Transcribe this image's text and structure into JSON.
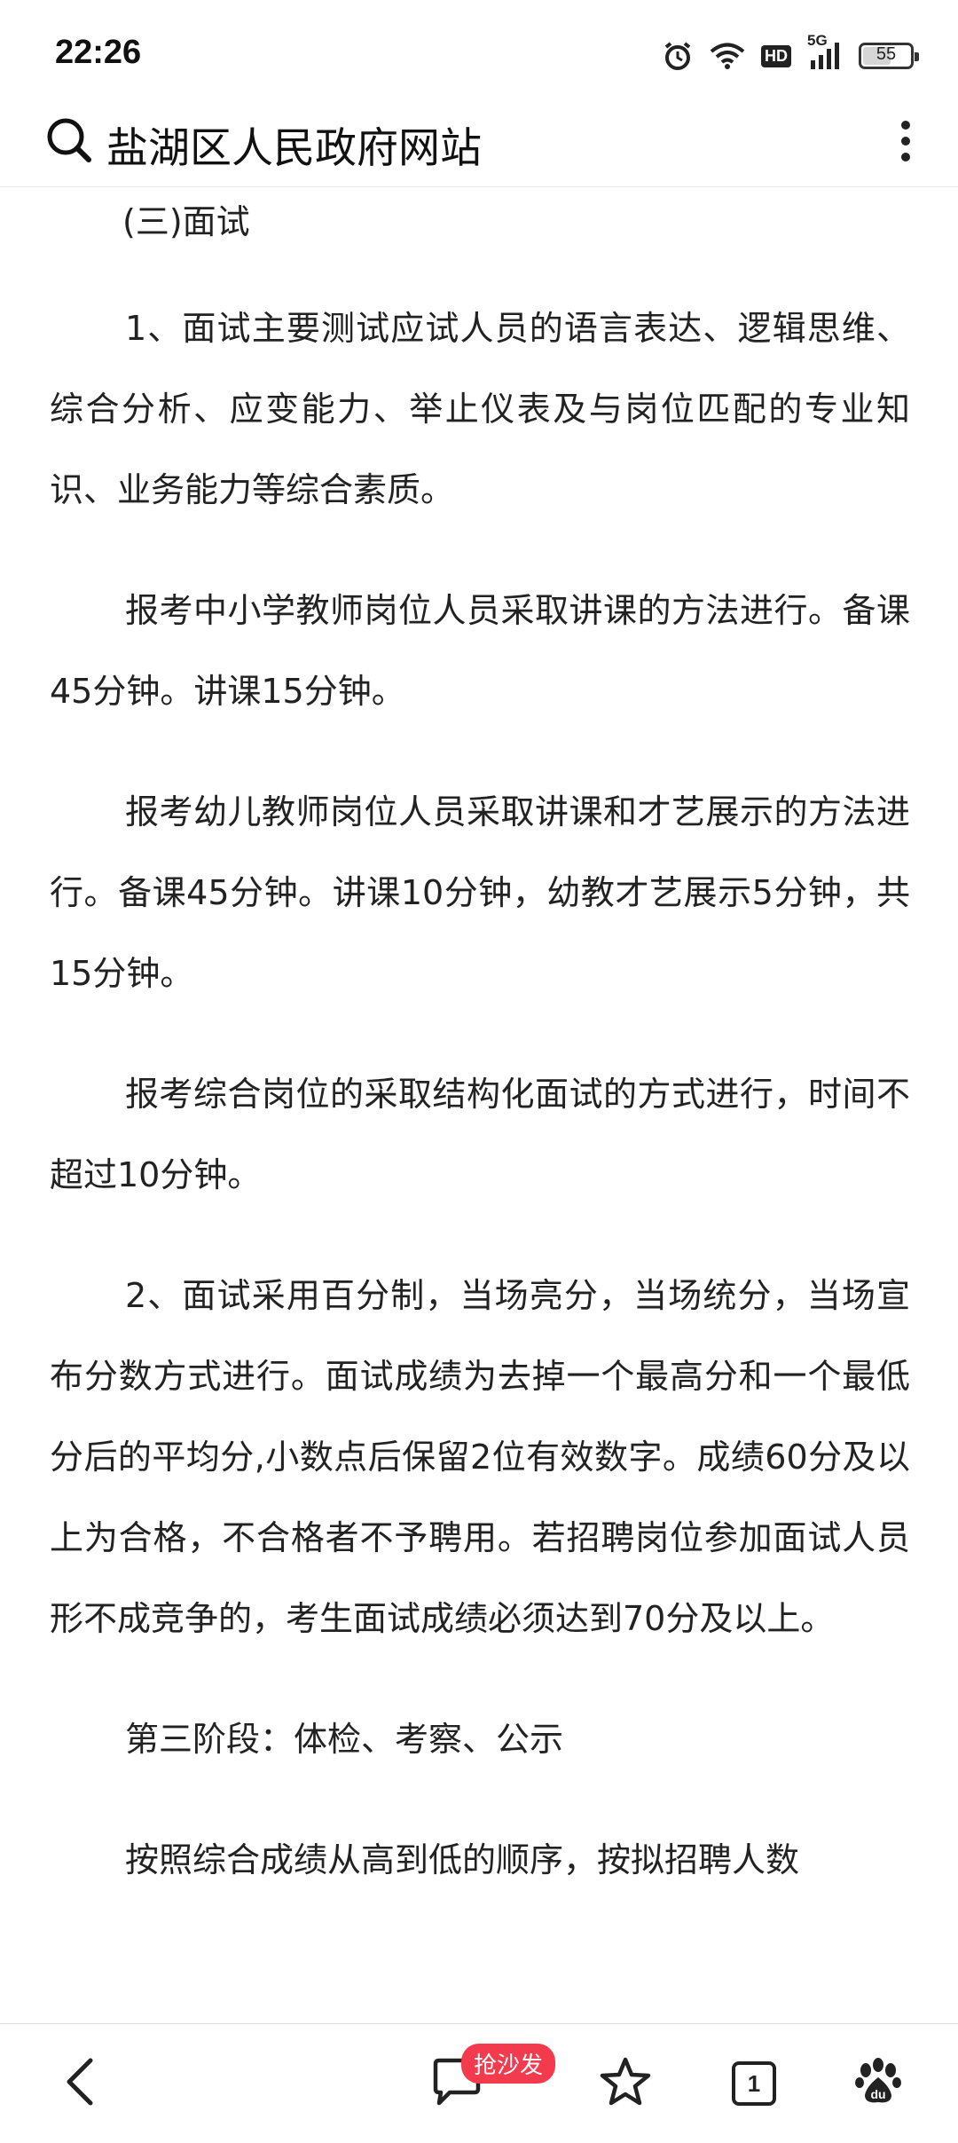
{
  "status_bar": {
    "time": "22:26",
    "icons": [
      "alarm-icon",
      "wifi-icon",
      "hd-icon",
      "5g-signal-icon",
      "battery-icon"
    ],
    "hd_label": "HD",
    "network_label": "5G",
    "battery_level": "55"
  },
  "search_bar": {
    "title": "盐湖区人民政府网站",
    "icons": [
      "search-icon",
      "more-menu-icon"
    ]
  },
  "article": {
    "heading": "(三)面试",
    "p1": "1、面试主要测试应试人员的语言表达、逻辑思维、综合分析、应变能力、举止仪表及与岗位匹配的专业知识、业务能力等综合素质。",
    "p2": "报考中小学教师岗位人员采取讲课的方法进行。备课45分钟。讲课15分钟。",
    "p3": "报考幼儿教师岗位人员采取讲课和才艺展示的方法进行。备课45分钟。讲课10分钟，幼教才艺展示5分钟，共15分钟。",
    "p4": "报考综合岗位的采取结构化面试的方式进行，时间不超过10分钟。",
    "p5": "2、面试采用百分制，当场亮分，当场统分，当场宣布分数方式进行。面试成绩为去掉一个最高分和一个最低分后的平均分,小数点后保留2位有效数字。成绩60分及以上为合格，不合格者不予聘用。若招聘岗位参加面试人员形不成竞争的，考生面试成绩必须达到70分及以上。",
    "stage3": "第三阶段：体检、考察、公示",
    "p6": "按照综合成绩从高到低的顺序，按拟招聘人数"
  },
  "bottom_nav": {
    "comment_badge": "抢沙发",
    "tab_count": "1",
    "icons": [
      "back-arrow-icon",
      "comment-icon",
      "star-icon",
      "tabs-icon",
      "baidu-paw-icon"
    ]
  }
}
